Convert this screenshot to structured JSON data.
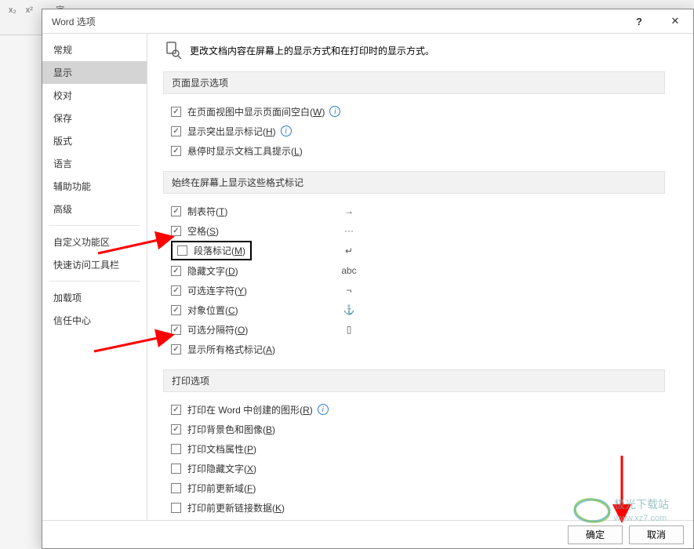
{
  "dialog": {
    "title": "Word 选项",
    "help_icon": "?",
    "close_icon": "✕"
  },
  "sidebar": {
    "items": [
      {
        "label": "常规",
        "selected": false
      },
      {
        "label": "显示",
        "selected": true
      },
      {
        "label": "校对",
        "selected": false
      },
      {
        "label": "保存",
        "selected": false
      },
      {
        "label": "版式",
        "selected": false
      },
      {
        "label": "语言",
        "selected": false
      },
      {
        "label": "辅助功能",
        "selected": false
      },
      {
        "label": "高级",
        "selected": false
      },
      {
        "label": "自定义功能区",
        "selected": false
      },
      {
        "label": "快速访问工具栏",
        "selected": false
      },
      {
        "label": "加载项",
        "selected": false
      },
      {
        "label": "信任中心",
        "selected": false
      }
    ]
  },
  "header": {
    "desc": "更改文档内容在屏幕上的显示方式和在打印时的显示方式。"
  },
  "sections": {
    "page_display": {
      "title": "页面显示选项",
      "opts": [
        {
          "label": "在页面视图中显示页面间空白(",
          "sc": "W",
          "tail": ")",
          "checked": true,
          "info": true
        },
        {
          "label": "显示突出显示标记(",
          "sc": "H",
          "tail": ")",
          "checked": true,
          "info": true
        },
        {
          "label": "悬停时显示文档工具提示(",
          "sc": "L",
          "tail": ")",
          "checked": true,
          "info": false
        }
      ]
    },
    "format_marks": {
      "title": "始终在屏幕上显示这些格式标记",
      "opts": [
        {
          "label": "制表符(",
          "sc": "T",
          "tail": ")",
          "checked": true,
          "symbol": "→"
        },
        {
          "label": "空格(",
          "sc": "S",
          "tail": ")",
          "checked": true,
          "symbol": "···"
        },
        {
          "label": "段落标记(",
          "sc": "M",
          "tail": ")",
          "checked": false,
          "symbol": "↵",
          "highlight": true
        },
        {
          "label": "隐藏文字(",
          "sc": "D",
          "tail": ")",
          "checked": true,
          "symbol": "abc"
        },
        {
          "label": "可选连字符(",
          "sc": "Y",
          "tail": ")",
          "checked": true,
          "symbol": "¬"
        },
        {
          "label": "对象位置(",
          "sc": "C",
          "tail": ")",
          "checked": true,
          "symbol": "⚓"
        },
        {
          "label": "可选分隔符(",
          "sc": "O",
          "tail": ")",
          "checked": true,
          "symbol": "▯"
        },
        {
          "label": "显示所有格式标记(",
          "sc": "A",
          "tail": ")",
          "checked": true,
          "symbol": ""
        }
      ]
    },
    "print": {
      "title": "打印选项",
      "opts": [
        {
          "label": "打印在 Word 中创建的图形(",
          "sc": "R",
          "tail": ")",
          "checked": true,
          "info": true
        },
        {
          "label": "打印背景色和图像(",
          "sc": "B",
          "tail": ")",
          "checked": true,
          "info": false
        },
        {
          "label": "打印文档属性(",
          "sc": "P",
          "tail": ")",
          "checked": false,
          "info": false
        },
        {
          "label": "打印隐藏文字(",
          "sc": "X",
          "tail": ")",
          "checked": false,
          "info": false
        },
        {
          "label": "打印前更新域(",
          "sc": "F",
          "tail": ")",
          "checked": false,
          "info": false
        },
        {
          "label": "打印前更新链接数据(",
          "sc": "K",
          "tail": ")",
          "checked": false,
          "info": false
        }
      ]
    }
  },
  "footer": {
    "ok": "确定",
    "cancel": "取消"
  },
  "watermark": {
    "line1": "极光下载站",
    "line2": "www.xz7.com"
  }
}
